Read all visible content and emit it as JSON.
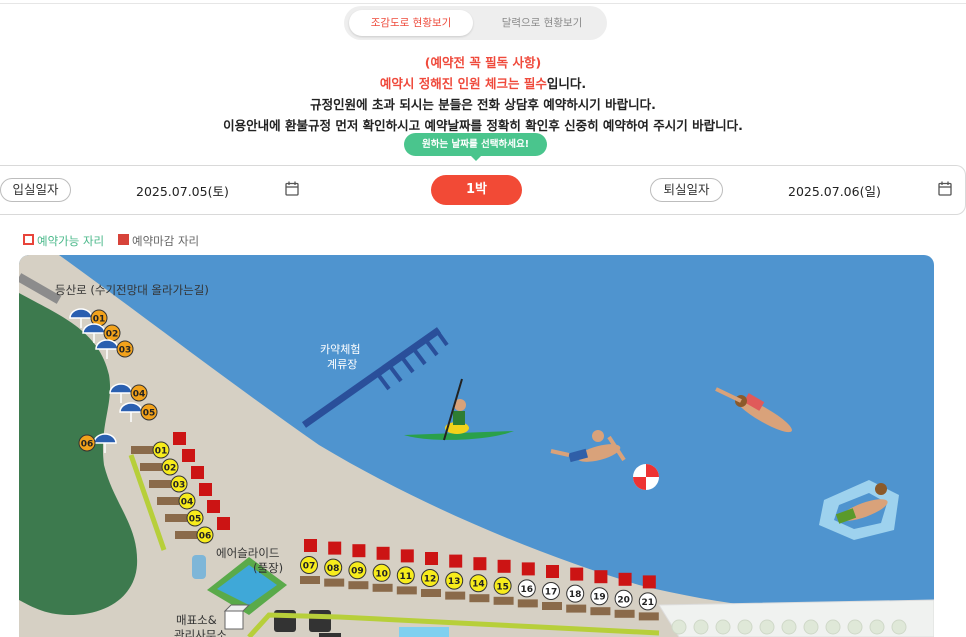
{
  "view_toggle": {
    "map_view_label": "조감도로 현황보기",
    "calendar_view_label": "달력으로 현황보기"
  },
  "notice": {
    "line1": "(예약전 꼭 필독 사항)",
    "line2_red": "예약시 정해진 인원 체크는 필수",
    "line2_rest": "입니다.",
    "line3": "규정인원에 초과 되시는 분들은 전화 상담후 예약하시기 바랍니다.",
    "line4": "이용안내에 환불규정 먼저 확인하시고 예약날짜를 정확히 확인후 신중히 예약하여 주시기 바랍니다."
  },
  "date_hint": "원하는 날짜를 선택하세요!",
  "checkin": {
    "label": "입실일자",
    "value": "2025.07.05(토)"
  },
  "nights": "1박",
  "checkout": {
    "label": "퇴실일자",
    "value": "2025.07.06(일)"
  },
  "legend": {
    "available": "예약가능 자리",
    "closed": "예약마감 자리",
    "available_color": "#e8443a",
    "closed_color": "#d7433a"
  },
  "map": {
    "trail_label": "등산로 (수기전망대 올라가는길)",
    "kayak_label_1": "카약체험",
    "kayak_label_2": "계류장",
    "slide_label_1": "에어슬라이드",
    "slide_label_2": "(풀장)",
    "office_label_1": "매표소&",
    "office_label_2": "관리사무소",
    "umbrella_sites": [
      "01",
      "02",
      "03",
      "04",
      "05",
      "06"
    ],
    "deck_sites_col": [
      "01",
      "02",
      "03",
      "04",
      "05",
      "06"
    ],
    "deck_sites_row_yellow": [
      "07",
      "08",
      "09",
      "10",
      "11",
      "12",
      "13",
      "14",
      "15"
    ],
    "deck_sites_row_white": [
      "16",
      "17",
      "18",
      "19",
      "20",
      "21"
    ],
    "colors": {
      "water": "#4f94cf",
      "sand": "#d6d0c4",
      "hill": "#3d7a4e",
      "site_yellow": "#f7ec1c",
      "site_orange": "#f2a21b",
      "closed_red": "#cc1414"
    }
  }
}
